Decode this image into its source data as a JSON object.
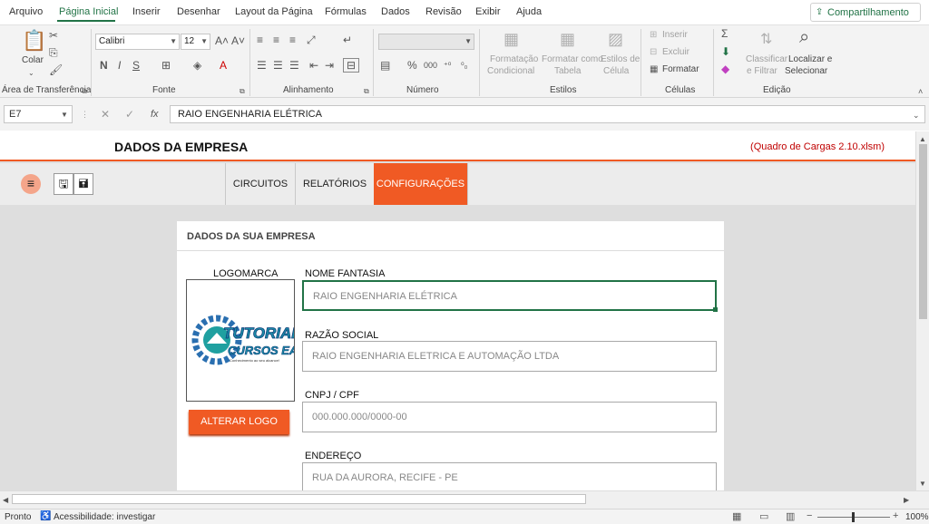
{
  "menu": {
    "items": [
      "Arquivo",
      "Página Inicial",
      "Inserir",
      "Desenhar",
      "Layout da Página",
      "Fórmulas",
      "Dados",
      "Revisão",
      "Exibir",
      "Ajuda"
    ],
    "share": "Compartilhamento"
  },
  "ribbon": {
    "clipboard": {
      "paste": "Colar",
      "label": "Área de Transferência"
    },
    "font": {
      "name": "Calibri",
      "size": "12",
      "bold": "N",
      "italic": "I",
      "underline": "S",
      "label": "Fonte"
    },
    "alignment": {
      "label": "Alinhamento"
    },
    "number": {
      "label": "Número"
    },
    "styles": {
      "cond1": "Formatação",
      "cond2": "Condicional",
      "table1": "Formatar como",
      "table2": "Tabela",
      "cell1": "Estilos de",
      "cell2": "Célula",
      "label": "Estilos"
    },
    "cells": {
      "insert": "Inserir",
      "delete": "Excluir",
      "format": "Formatar",
      "label": "Células"
    },
    "editing": {
      "sort1": "Classificar",
      "sort2": "e Filtrar",
      "find1": "Localizar e",
      "find2": "Selecionar",
      "label": "Edição"
    }
  },
  "formula_bar": {
    "cell_ref": "E7",
    "fx": "fx",
    "content": "RAIO ENGENHARIA ELÉTRICA"
  },
  "sheet": {
    "title": "DADOS DA EMPRESA",
    "file_name": "(Quadro de Cargas 2.10.xlsm)",
    "tabs": [
      "CIRCUITOS",
      "RELATÓRIOS",
      "CONFIGURAÇÕES"
    ],
    "active_tab": "CONFIGURAÇÕES",
    "card": {
      "title": "DADOS DA SUA EMPRESA",
      "logo_label": "LOGOMARCA",
      "logo_line1": "TUTORIAL",
      "logo_line2": "CURSOS EAD",
      "logo_tagline": "Conhecimento ao seu alcance!",
      "alter_logo": "ALTERAR LOGO",
      "fields": [
        {
          "label": "NOME FANTASIA",
          "value": "RAIO ENGENHARIA ELÉTRICA"
        },
        {
          "label": "RAZÃO SOCIAL",
          "value": "RAIO ENGENHARIA ELETRICA E AUTOMAÇÃO LTDA"
        },
        {
          "label": "CNPJ / CPF",
          "value": "000.000.000/0000-00"
        },
        {
          "label": "ENDEREÇO",
          "value": "RUA DA AURORA, RECIFE - PE"
        }
      ]
    }
  },
  "status": {
    "ready": "Pronto",
    "accessibility": "Acessibilidade: investigar",
    "zoom": "100%"
  },
  "colors": {
    "accent": "#f05a24",
    "excel_green": "#217346",
    "file_name": "#c00000"
  }
}
